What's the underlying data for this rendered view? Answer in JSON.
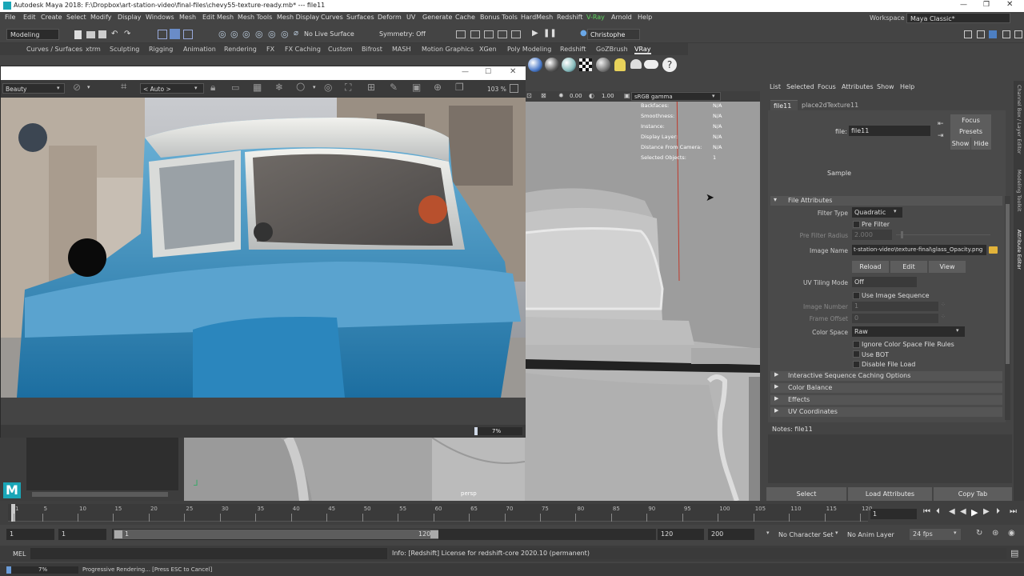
{
  "titlebar": {
    "title": "Autodesk Maya 2018: F:\\Dropbox\\art-station-video\\final-files\\chevy55-texture-ready.mb*   ---   file11",
    "workspace_label": "Workspace :",
    "workspace_value": "Maya Classic*"
  },
  "menu": [
    "File",
    "Edit",
    "Create",
    "Select",
    "Modify",
    "Display",
    "Windows",
    "Mesh",
    "Edit Mesh",
    "Mesh Tools",
    "Mesh Display",
    "Curves",
    "Surfaces",
    "Deform",
    "UV",
    "Generate",
    "Cache",
    "Bonus Tools",
    "HardMesh",
    "Redshift",
    "V-Ray",
    "Arnold",
    "Help"
  ],
  "status": {
    "mode": "Modeling",
    "live_surface": "No Live Surface",
    "symmetry": "Symmetry: Off",
    "user": "Christophe"
  },
  "shelf_tabs": [
    "Curves / Surfaces",
    "xtrm",
    "Sculpting",
    "Rigging",
    "Animation",
    "Rendering",
    "FX",
    "FX Caching",
    "Custom",
    "Bifrost",
    "MASH",
    "Motion Graphics",
    "XGen",
    "Poly Modeling",
    "Redshift",
    "GoZBrush",
    "VRay"
  ],
  "render_view": {
    "aov": "Beauty",
    "camera": "< Auto >",
    "zoom": "103 %",
    "progress_text": "7%",
    "progress": 0.07
  },
  "viewport": {
    "exposure": "0.00",
    "gamma": "1.00",
    "color_space": "sRGB gamma",
    "camera_label": "persp",
    "hud": [
      [
        "Backfaces:",
        "N/A"
      ],
      [
        "Smoothness:",
        "N/A"
      ],
      [
        "Instance:",
        "N/A"
      ],
      [
        "Display Layer:",
        "N/A"
      ],
      [
        "Distance From Camera:",
        "N/A"
      ],
      [
        "Selected Objects:",
        "1"
      ]
    ]
  },
  "attribute_editor": {
    "menu": [
      "List",
      "Selected",
      "Focus",
      "Attributes",
      "Show",
      "Help"
    ],
    "tabs": [
      "file11",
      "place2dTexture11"
    ],
    "file_label": "file:",
    "file_value": "file11",
    "focus": "Focus",
    "presets": "Presets",
    "show": "Show",
    "hide": "Hide",
    "sample": "Sample",
    "file_attributes": "File Attributes",
    "filter_type_label": "Filter Type",
    "filter_type": "Quadratic",
    "pre_filter": "Pre Filter",
    "pre_filter_radius_label": "Pre Filter Radius",
    "pre_filter_radius": "2.000",
    "image_name_label": "Image Name",
    "image_name": "t-station-video\\texture-final\\glass_Opacity.png",
    "reload": "Reload",
    "edit": "Edit",
    "view": "View",
    "uv_tiling_label": "UV Tiling Mode",
    "uv_tiling": "Off",
    "use_image_sequence": "Use Image Sequence",
    "image_number_label": "Image Number",
    "image_number": "1",
    "frame_offset_label": "Frame Offset",
    "frame_offset": "0",
    "color_space_label": "Color Space",
    "color_space": "Raw",
    "ignore_cs": "Ignore Color Space File Rules",
    "use_bot": "Use BOT",
    "disable_file_load": "Disable File Load",
    "sections": [
      "Interactive Sequence Caching Options",
      "Color Balance",
      "Effects",
      "UV Coordinates"
    ],
    "notes": "Notes: file11",
    "select": "Select",
    "load_attributes": "Load Attributes",
    "copy_tab": "Copy Tab"
  },
  "side_tabs": [
    "Channel Box / Layer Editor",
    "Modeling Toolkit",
    "Attribute Editor"
  ],
  "timeline": {
    "ticks": [
      "1",
      "5",
      "10",
      "15",
      "20",
      "25",
      "30",
      "35",
      "40",
      "45",
      "50",
      "55",
      "60",
      "65",
      "70",
      "75",
      "80",
      "85",
      "90",
      "95",
      "100",
      "105",
      "110",
      "115",
      "120"
    ],
    "current": "1"
  },
  "range": {
    "start": "1",
    "inner_start": "1",
    "slider_start": "1",
    "slider_end": "120",
    "end": "120",
    "total_end": "200",
    "character_set": "No Character Set",
    "anim_layer": "No Anim Layer",
    "fps": "24 fps"
  },
  "cmdline": {
    "lang": "MEL",
    "result": "Info: [Redshift] License for redshift-core 2020.10 (permanent)"
  },
  "helpline": {
    "progress_text": "7%",
    "progress": 0.07,
    "message": "Progressive Rendering... [Press ESC to Cancel]"
  }
}
